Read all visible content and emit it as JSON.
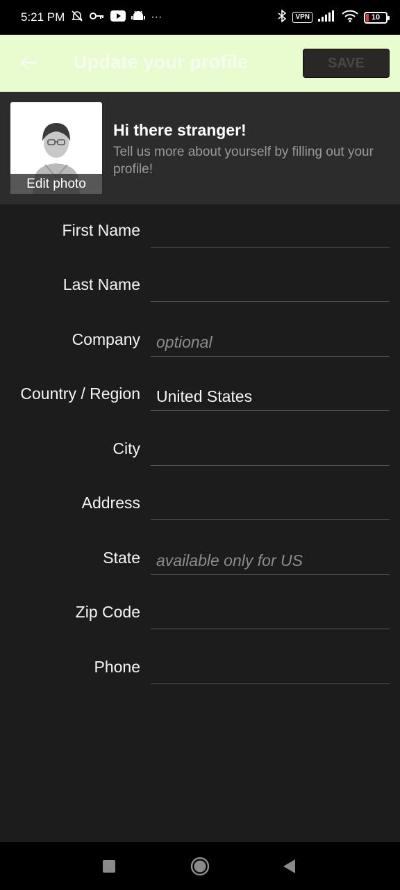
{
  "status_bar": {
    "time": "5:21 PM",
    "icons": [
      "mute-bell-icon",
      "key-icon",
      "youtube-icon",
      "android-icon",
      "more-dots-icon"
    ],
    "right_icons": [
      "bluetooth-icon",
      "vpn-icon",
      "signal-icon",
      "wifi-icon",
      "battery-icon"
    ],
    "vpn_label": "VPN",
    "battery_level": "10",
    "more_glyph": "···"
  },
  "app_bar": {
    "title": "Update your profile",
    "save_label": "SAVE",
    "back_icon": "arrow-left-icon"
  },
  "profile_header": {
    "edit_photo_label": "Edit photo",
    "greeting_title": "Hi there stranger!",
    "greeting_subtitle": "Tell us more about yourself by filling out your profile!"
  },
  "form": {
    "fields": [
      {
        "label": "First Name",
        "value": "",
        "placeholder": ""
      },
      {
        "label": "Last Name",
        "value": "",
        "placeholder": ""
      },
      {
        "label": "Company",
        "value": "",
        "placeholder": "optional"
      },
      {
        "label": "Country / Region",
        "value": "United States",
        "placeholder": ""
      },
      {
        "label": "City",
        "value": "",
        "placeholder": ""
      },
      {
        "label": "Address",
        "value": "",
        "placeholder": ""
      },
      {
        "label": "State",
        "value": "",
        "placeholder": "available only for US"
      },
      {
        "label": "Zip Code",
        "value": "",
        "placeholder": ""
      },
      {
        "label": "Phone",
        "value": "",
        "placeholder": ""
      }
    ]
  },
  "nav_bar": {
    "buttons": [
      "recents-square-icon",
      "home-circle-icon",
      "back-triangle-icon"
    ]
  },
  "colors": {
    "app_bar_bg": "#e8fcd0",
    "background": "#1c1c1c",
    "header_bg": "#2c2c2c",
    "battery_low": "#e53935"
  }
}
